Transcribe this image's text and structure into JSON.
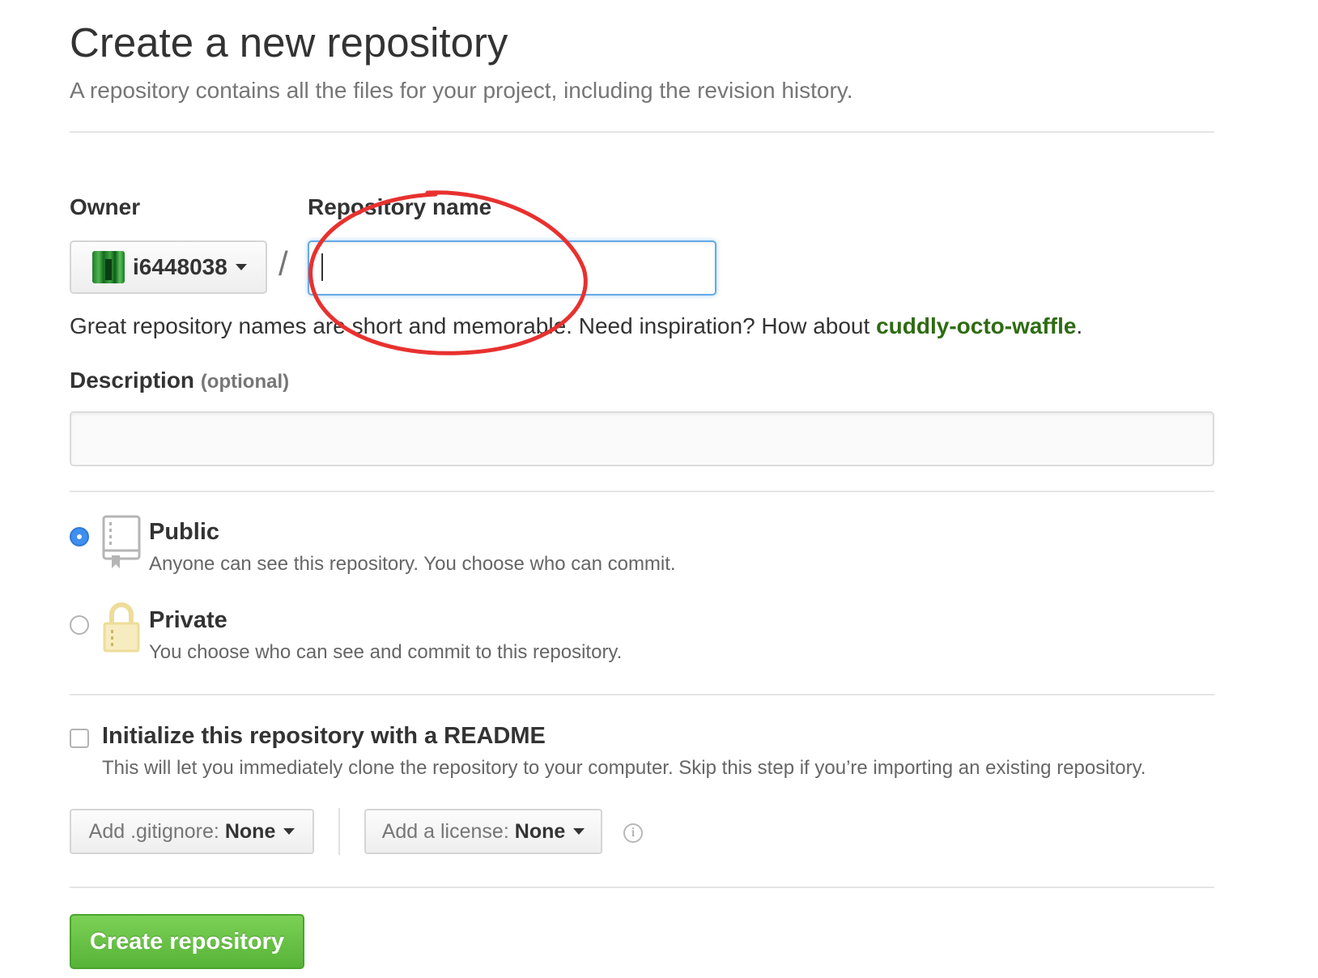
{
  "header": {
    "title": "Create a new repository",
    "subtitle": "A repository contains all the files for your project, including the revision history."
  },
  "owner": {
    "label": "Owner",
    "value": "i6448038",
    "slash": "/"
  },
  "repo_name": {
    "label": "Repository name",
    "value": "",
    "hint_prefix": "Great repository names are short and memorable. Need inspiration? How about ",
    "hint_suggestion": "cuddly-octo-waffle",
    "hint_suffix": "."
  },
  "description": {
    "label": "Description",
    "optional": "(optional)",
    "value": ""
  },
  "visibility": {
    "public": {
      "title": "Public",
      "desc": "Anyone can see this repository. You choose who can commit.",
      "checked": true
    },
    "private": {
      "title": "Private",
      "desc": "You choose who can see and commit to this repository.",
      "checked": false
    }
  },
  "init": {
    "title": "Initialize this repository with a README",
    "desc": "This will let you immediately clone the repository to your computer. Skip this step if you’re importing an existing repository.",
    "checked": false
  },
  "gitignore": {
    "label": "Add .gitignore:",
    "value": "None"
  },
  "license": {
    "label": "Add a license:",
    "value": "None"
  },
  "info_glyph": "i",
  "submit": {
    "label": "Create repository"
  },
  "colors": {
    "suggestion": "#2e6b12",
    "primary_button": "#57b338",
    "focus_border": "#66a9e6",
    "radio_checked": "#3e8ff0",
    "annotation": "#e8312f"
  },
  "icons": {
    "public": "repo-book-icon",
    "private": "padlock-icon",
    "info": "info-icon",
    "dropdown": "caret-down-icon"
  }
}
